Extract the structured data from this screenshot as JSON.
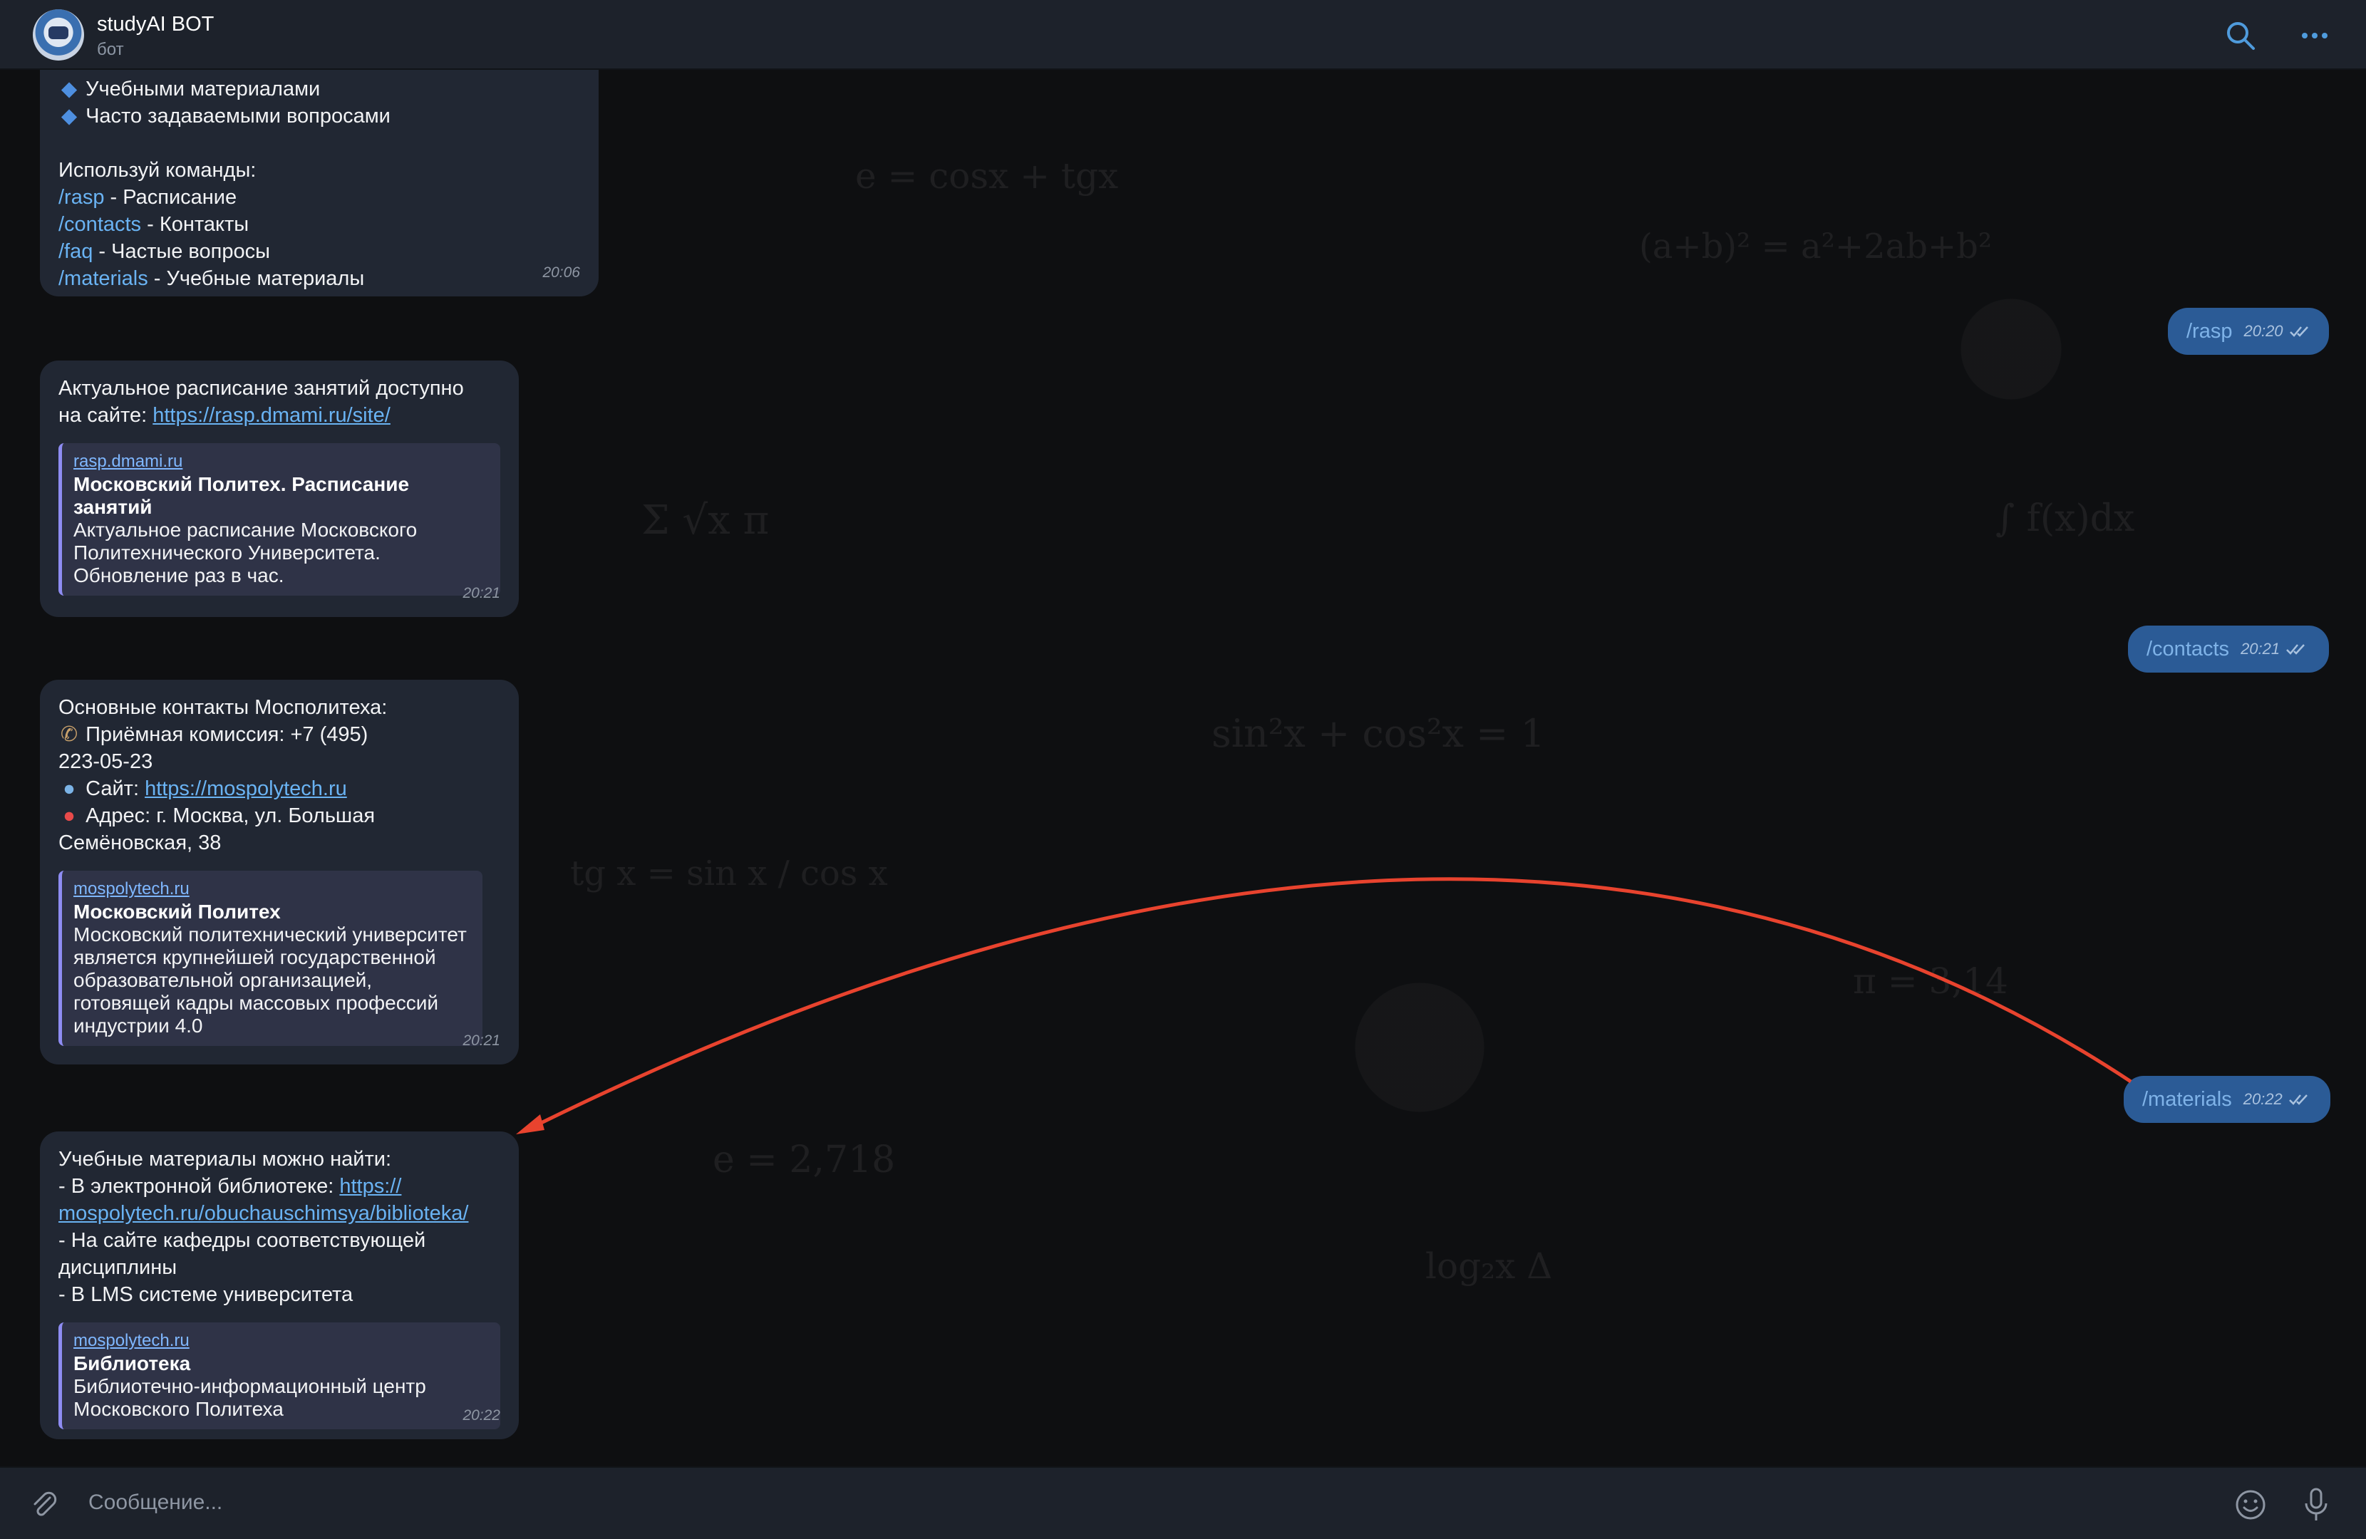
{
  "header": {
    "bot_name": "studyAI BOT",
    "status": "бот"
  },
  "messages": {
    "m1": {
      "lines": [
        "Учебными материалами",
        "Часто задаваемыми вопросами"
      ],
      "intro": "Используй команды:",
      "commands": [
        {
          "cmd": "/rasp",
          "desc": " - Расписание"
        },
        {
          "cmd": "/contacts",
          "desc": " - Контакты"
        },
        {
          "cmd": "/faq",
          "desc": " - Частые вопросы"
        },
        {
          "cmd": "/materials",
          "desc": " - Учебные материалы"
        }
      ],
      "time": "20:06"
    },
    "m2": {
      "text1": "Актуальное расписание занятий доступно",
      "text2": "на сайте: ",
      "link": "https://rasp.dmami.ru/site/",
      "preview_site": "rasp.dmami.ru",
      "preview_title": "Московский Политех. Расписание занятий",
      "preview_desc": "Актуальное расписание Московского Политехнического Университета. Обновление раз в час.",
      "time": "20:21"
    },
    "m3": {
      "l1": "Основные контакты Мосполитеха:",
      "l2": "Приёмная комиссия: +7 (495)",
      "l3": "223-05-23",
      "l4_pre": "Сайт: ",
      "l4_link": "https://mospolytech.ru",
      "l5": "Адрес: г. Москва, ул. Большая",
      "l6": "Семёновская, 38",
      "preview_site": "mospolytech.ru",
      "preview_title": "Московский Политех",
      "preview_desc": "Московский политехнический университет является крупнейшей государственной образовательной организацией, готовящей кадры массовых профессий индустрии 4.0",
      "time": "20:21"
    },
    "m4": {
      "l1": "Учебные материалы можно найти:",
      "l2_pre": "- В электронной библиотеке: ",
      "l2_link_a": "https://",
      "l2_link_b": "mospolytech.ru/obuchauschimsya/biblioteka/",
      "l3": "- На сайте кафедры соответствующей",
      "l4": "дисциплины",
      "l5": "- В LMS системе университета",
      "preview_site": "mospolytech.ru",
      "preview_title": "Библиотека",
      "preview_desc": "Библиотечно-информационный центр Московского Политеха",
      "time": "20:22"
    }
  },
  "outgoing": [
    {
      "text": "/rasp",
      "time": "20:20"
    },
    {
      "text": "/contacts",
      "time": "20:21"
    },
    {
      "text": "/materials",
      "time": "20:22"
    }
  ],
  "composer": {
    "placeholder": "Сообщение..."
  },
  "colors": {
    "accent": "#6ab3f3",
    "incoming_bubble": "#212733",
    "outgoing_bubble": "#2b5b96",
    "annotation_arrow": "#e8432e"
  }
}
